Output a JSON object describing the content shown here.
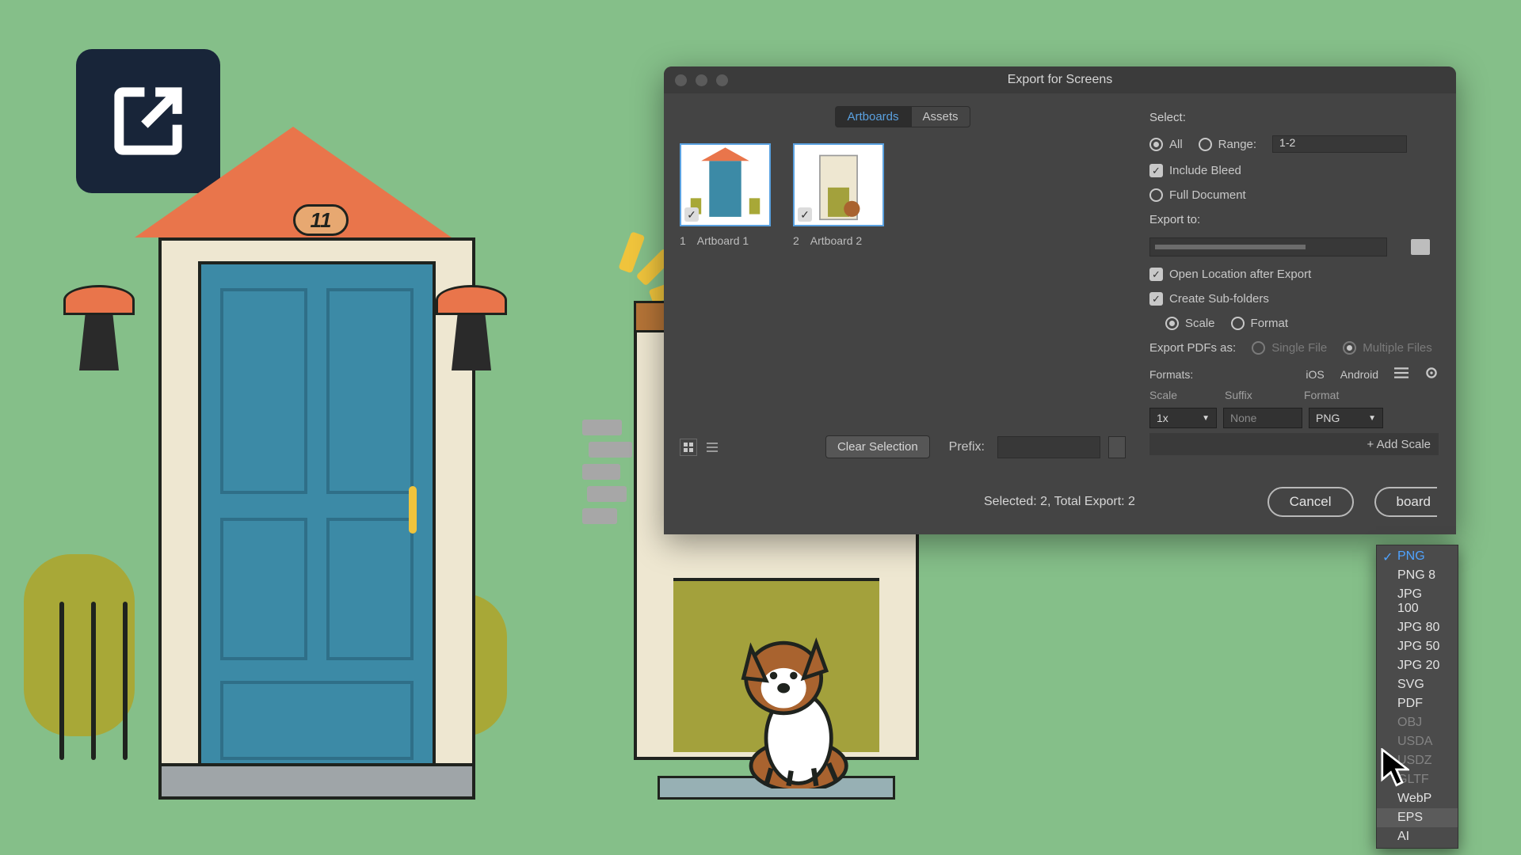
{
  "house_number": "11",
  "dialog": {
    "title": "Export for Screens",
    "tabs": {
      "artboards": "Artboards",
      "assets": "Assets"
    },
    "artboards": [
      {
        "index": "1",
        "name": "Artboard 1"
      },
      {
        "index": "2",
        "name": "Artboard 2"
      }
    ],
    "clear_selection": "Clear Selection",
    "prefix_label": "Prefix:",
    "status": "Selected: 2, Total Export: 2",
    "cancel": "Cancel",
    "export_artboard_partial": "board",
    "select": {
      "label": "Select:",
      "all": "All",
      "range": "Range:",
      "range_value": "1-2",
      "include_bleed": "Include Bleed",
      "full_document": "Full Document"
    },
    "export_to": {
      "label": "Export to:",
      "open_location": "Open Location after Export",
      "create_subfolders": "Create Sub-folders",
      "scale": "Scale",
      "format": "Format"
    },
    "export_pdfs": {
      "label": "Export PDFs as:",
      "single": "Single File",
      "multiple": "Multiple Files"
    },
    "formats": {
      "label": "Formats:",
      "ios": "iOS",
      "android": "Android",
      "col_scale": "Scale",
      "col_suffix": "Suffix",
      "col_format": "Format",
      "scale_value": "1x",
      "suffix_value": "None",
      "format_value": "PNG",
      "add_scale": "+ Add Scale"
    },
    "format_menu": [
      {
        "label": "PNG",
        "state": "sel"
      },
      {
        "label": "PNG 8",
        "state": ""
      },
      {
        "label": "JPG 100",
        "state": ""
      },
      {
        "label": "JPG 80",
        "state": ""
      },
      {
        "label": "JPG 50",
        "state": ""
      },
      {
        "label": "JPG 20",
        "state": ""
      },
      {
        "label": "SVG",
        "state": ""
      },
      {
        "label": "PDF",
        "state": ""
      },
      {
        "label": "OBJ",
        "state": "dis"
      },
      {
        "label": "USDA",
        "state": "dis"
      },
      {
        "label": "USDZ",
        "state": "dis"
      },
      {
        "label": "GLTF",
        "state": "dis"
      },
      {
        "label": "WebP",
        "state": ""
      },
      {
        "label": "EPS",
        "state": "hov"
      },
      {
        "label": "AI",
        "state": ""
      }
    ]
  }
}
